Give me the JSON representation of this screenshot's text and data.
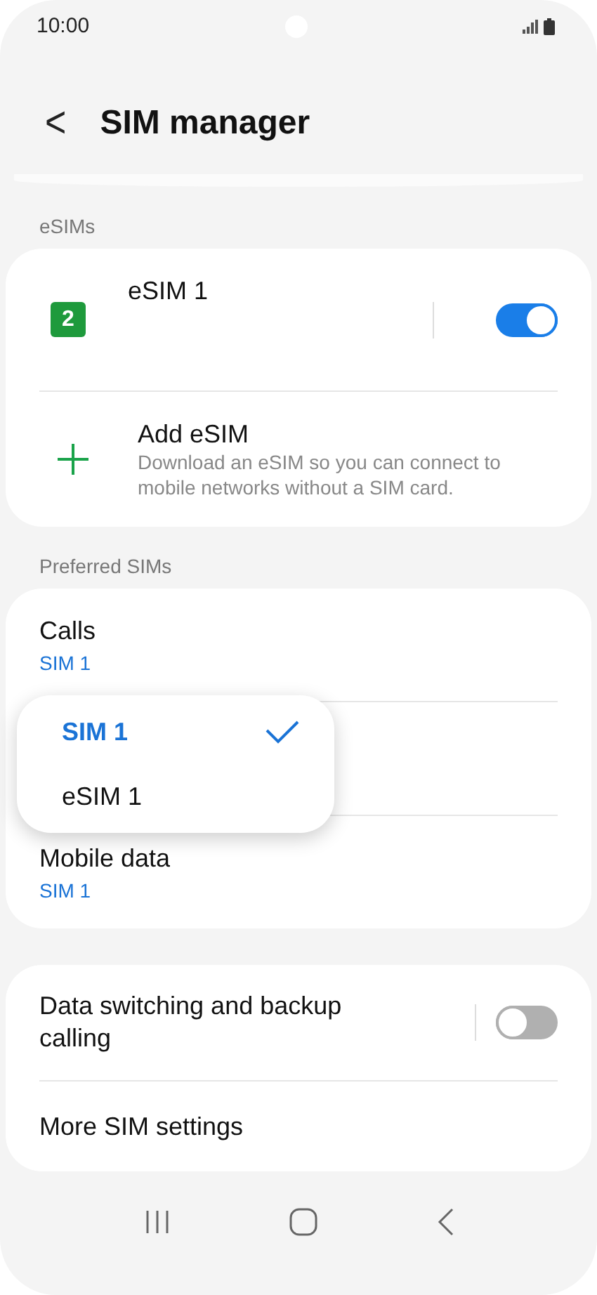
{
  "status_bar": {
    "time": "10:00"
  },
  "header": {
    "back": "<",
    "title": "SIM manager"
  },
  "sections": [
    {
      "label": "eSIMs",
      "items": [
        {
          "kind": "sim",
          "badge": "2",
          "title": "eSIM 1",
          "on": true
        },
        {
          "kind": "add",
          "title": "Add eSIM",
          "subtitle": "Download an eSIM so you can connect to mobile networks without a SIM card."
        }
      ]
    },
    {
      "label": "Preferred SIMs",
      "items": [
        {
          "kind": "pref",
          "title": "Calls",
          "value": "SIM 1"
        },
        {
          "kind": "pref_hidden"
        },
        {
          "kind": "pref",
          "title": "Mobile data",
          "value": "SIM 1"
        }
      ]
    }
  ],
  "popup": {
    "options": [
      {
        "label": "SIM 1",
        "selected": true
      },
      {
        "label": "eSIM 1",
        "selected": false
      }
    ]
  },
  "settings": [
    {
      "kind": "toggle",
      "title": "Data switching and backup calling",
      "on": false
    },
    {
      "kind": "link",
      "title": "More SIM settings"
    }
  ]
}
